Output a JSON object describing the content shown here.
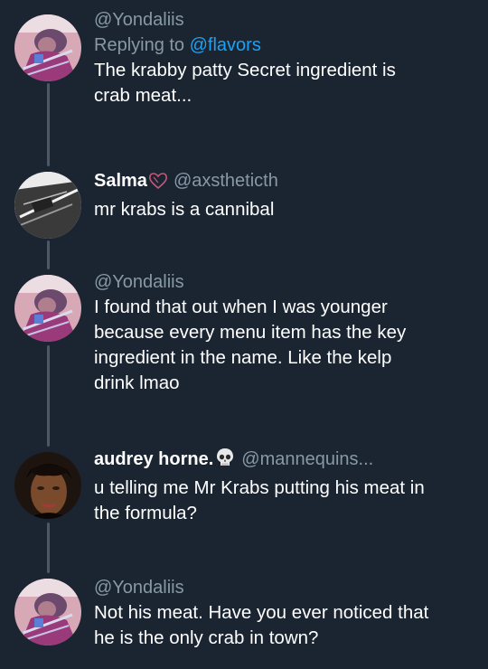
{
  "thread": [
    {
      "handle": "@Yondaliis",
      "replying_prefix": "Replying to ",
      "replying_mention": "@flavors",
      "lines": [
        "The krabby patty Secret ingredient is",
        "crab meat..."
      ]
    },
    {
      "name": "Salma",
      "name_emoji": "heart-doodle-icon",
      "handle": "@axstheticth",
      "lines": [
        "mr krabs is a cannibal"
      ]
    },
    {
      "handle": "@Yondaliis",
      "lines": [
        "I found that out when I was younger",
        "because every menu item has the key",
        "ingredient in the name. Like the kelp",
        "drink lmao"
      ]
    },
    {
      "name": "audrey horne.",
      "name_emoji": "skull-icon",
      "handle": "@mannequins...",
      "lines": [
        "u telling me Mr Krabs putting his meat in",
        "the formula?"
      ]
    },
    {
      "handle": "@Yondaliis",
      "lines": [
        "Not his meat. Have you ever noticed that",
        "he is the only crab in town?"
      ]
    }
  ],
  "colors": {
    "background": "#1b2532",
    "handle": "#8899a6",
    "mention": "#1da1f2",
    "thread_line": "#4b5866",
    "text": "#ffffff"
  }
}
